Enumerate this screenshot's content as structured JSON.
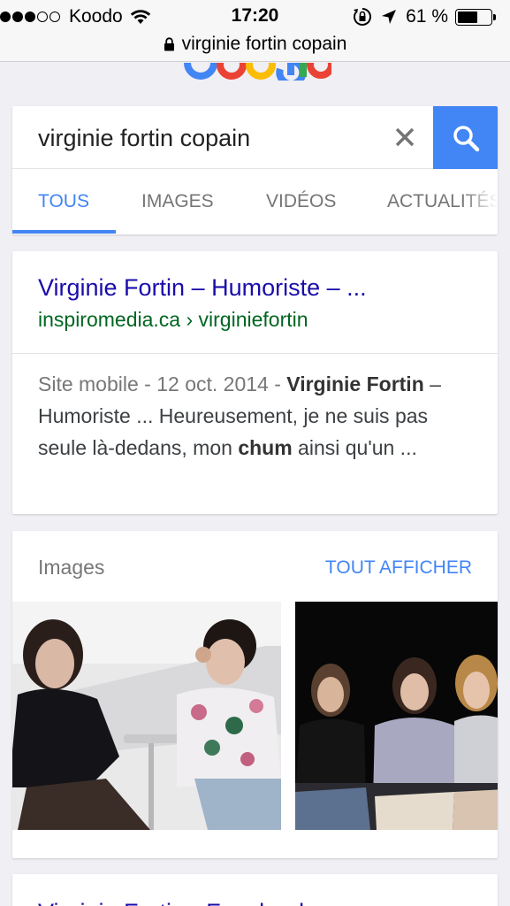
{
  "status_bar": {
    "carrier": "Koodo",
    "time": "17:20",
    "battery_percent": "61 %",
    "battery_level": 0.61,
    "url": "virginie fortin copain",
    "icons": [
      "signal-dots-icon",
      "wifi-icon",
      "rotation-lock-icon",
      "location-arrow-icon",
      "battery-icon",
      "lock-icon"
    ]
  },
  "search": {
    "query": "virginie fortin copain",
    "clear_icon": "close-icon",
    "submit_icon": "search-icon"
  },
  "tabs": [
    {
      "label": "TOUS",
      "active": true
    },
    {
      "label": "IMAGES",
      "active": false
    },
    {
      "label": "VIDÉOS",
      "active": false
    },
    {
      "label": "ACTUALITÉS",
      "active": false
    }
  ],
  "result": {
    "title": "Virginie Fortin – Humoriste – ...",
    "url": "inspiromedia.ca › virginiefortin",
    "snippet_meta": "Site mobile - 12 oct. 2014 - ",
    "snippet_bold1": "Virginie Fortin",
    "snippet_text1": " – Humoriste ... Heureusement, je ne suis pas seule là-dedans, mon ",
    "snippet_bold2": "chum",
    "snippet_text2": " ainsi qu'un ..."
  },
  "images": {
    "heading": "Images",
    "see_all": "TOUT AFFICHER"
  },
  "next_result": {
    "title": "Virginie Fortin - Facebook"
  },
  "colors": {
    "accent_blue": "#4285f4",
    "link": "#1a0dab",
    "url_green": "#006621"
  }
}
